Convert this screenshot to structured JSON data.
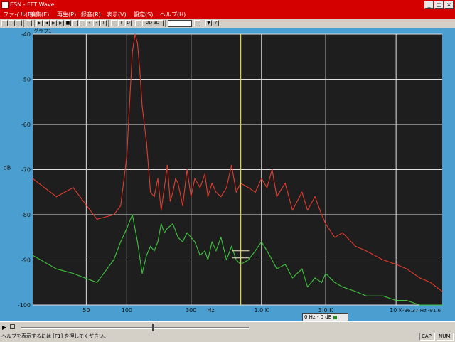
{
  "window": {
    "title": "ESN - FFT Wave",
    "min": "_",
    "max": "□",
    "close": "×"
  },
  "menu": [
    "ファイル(F)",
    "編集(E)",
    "再生(P)",
    "録音(R)",
    "表示(V)",
    "設定(S)",
    "ヘルプ(H)"
  ],
  "toolbar_glyphs": [
    "▶",
    "◀",
    "▶",
    "▶",
    "■",
    "I",
    "I",
    "‹",
    "›",
    "I",
    "I",
    "I",
    "D",
    "▼",
    "?"
  ],
  "toolbar_text": "2D 3D A3",
  "graph_label": "グラフ1",
  "chart_data": {
    "type": "line",
    "ylabel": "dB",
    "xlabel": "Hz",
    "y_ticks": [
      "-40",
      "-50",
      "-60",
      "-70",
      "-80",
      "-90",
      "-100"
    ],
    "ylim": [
      -100,
      -40
    ],
    "x_scale": "log",
    "x_ticks": [
      "50",
      "100",
      "300",
      "1.0 K",
      "3.0 K",
      "10 K"
    ],
    "x_tick_values": [
      50,
      100,
      300,
      1000,
      3000,
      10000
    ],
    "xlim": [
      20,
      22000
    ],
    "grid": true,
    "cursor_hz": 700,
    "series": [
      {
        "color": "#e43b2e",
        "x": [
          20,
          30,
          40,
          60,
          80,
          90,
          100,
          105,
          110,
          115,
          120,
          125,
          130,
          140,
          150,
          160,
          170,
          180,
          190,
          200,
          210,
          220,
          230,
          240,
          260,
          280,
          300,
          320,
          350,
          380,
          400,
          430,
          460,
          500,
          550,
          600,
          650,
          700,
          800,
          900,
          1000,
          1100,
          1200,
          1300,
          1500,
          1700,
          2000,
          2200,
          2500,
          2800,
          3000,
          3500,
          4000,
          5000,
          6000,
          8000,
          10000,
          12000,
          15000,
          18000,
          22000
        ],
        "y": [
          -72,
          -76,
          -74,
          -81,
          -80,
          -78,
          -67,
          -55,
          -44,
          -40,
          -42,
          -48,
          -56,
          -64,
          -75,
          -76,
          -72,
          -79,
          -74,
          -69,
          -77,
          -75,
          -72,
          -73,
          -78,
          -70,
          -76,
          -72,
          -74,
          -71,
          -76,
          -73,
          -75,
          -76,
          -74,
          -69,
          -75,
          -73,
          -74,
          -75,
          -72,
          -74,
          -70,
          -76,
          -73,
          -79,
          -75,
          -79,
          -76,
          -80,
          -82,
          -85,
          -84,
          -87,
          -88,
          -90,
          -91,
          -92,
          -94,
          -95,
          -97
        ]
      },
      {
        "color": "#3ec43e",
        "x": [
          20,
          30,
          40,
          60,
          80,
          90,
          100,
          110,
          120,
          130,
          140,
          150,
          160,
          170,
          180,
          190,
          200,
          220,
          240,
          260,
          280,
          300,
          320,
          350,
          380,
          400,
          430,
          460,
          500,
          550,
          600,
          650,
          700,
          800,
          900,
          1000,
          1100,
          1200,
          1300,
          1500,
          1700,
          2000,
          2200,
          2500,
          2800,
          3000,
          3500,
          4000,
          5000,
          6000,
          8000,
          10000,
          12000,
          15000,
          18000,
          22000
        ],
        "y": [
          -89,
          -92,
          -93,
          -95,
          -90,
          -86,
          -83,
          -80,
          -86,
          -93,
          -89,
          -87,
          -88,
          -86,
          -82,
          -84,
          -83,
          -82,
          -85,
          -86,
          -84,
          -85,
          -86,
          -89,
          -88,
          -90,
          -86,
          -88,
          -85,
          -90,
          -87,
          -90,
          -91,
          -90,
          -88,
          -86,
          -88,
          -90,
          -92,
          -91,
          -94,
          -92,
          -96,
          -94,
          -95,
          -93,
          -95,
          -96,
          -97,
          -98,
          -98,
          -99,
          -99,
          -100,
          -100,
          -100
        ]
      }
    ]
  },
  "status": {
    "help": "ヘルプを表示するには [F1] を押してください。",
    "caps": "CAP",
    "num": "NUM"
  },
  "readout": "-96.37 Hz -91.6",
  "cursor_readout": "0 Hz  -  0 dB",
  "colors": {
    "frame": "#4a9fd0",
    "plot_bg": "#1e1e1e",
    "grid": "#e0e0e0",
    "cursor": "#d7d25c",
    "titlebar": "#d40000"
  }
}
